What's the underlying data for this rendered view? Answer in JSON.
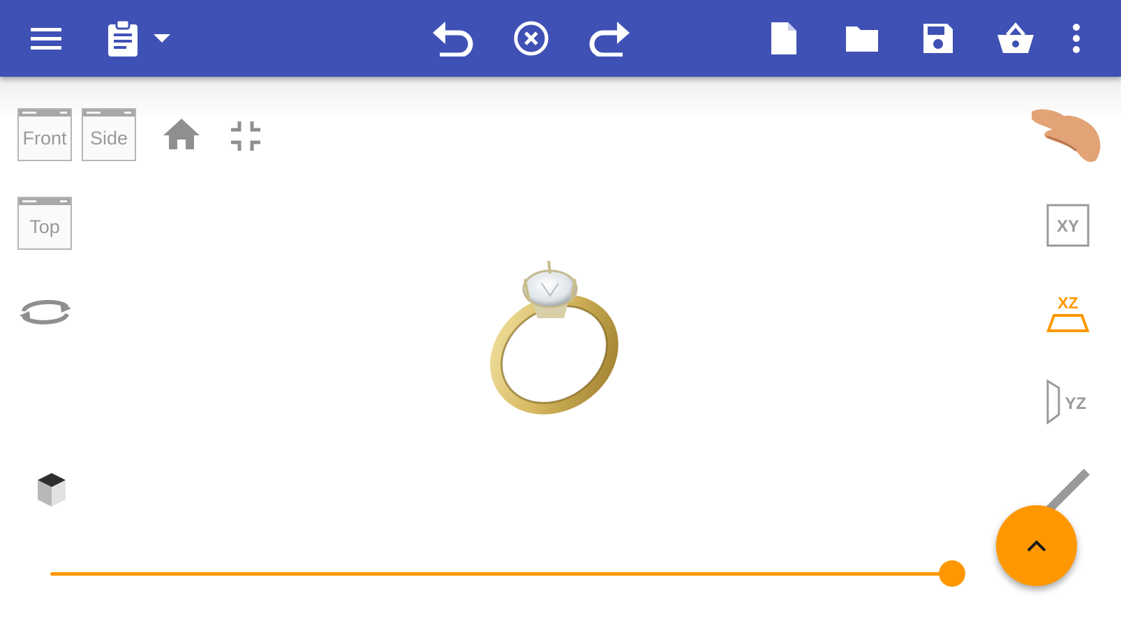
{
  "toolbar": {
    "icons": [
      "menu-icon",
      "clipboard-icon",
      "dropdown-icon",
      "undo-icon",
      "cancel-icon",
      "redo-icon",
      "new-file-icon",
      "open-folder-icon",
      "save-icon",
      "basket-icon",
      "more-vert-icon"
    ]
  },
  "views": {
    "front": "Front",
    "side": "Side",
    "top": "Top"
  },
  "planes": {
    "xy": "XY",
    "xz": "XZ",
    "yz": "YZ",
    "active": "XZ"
  },
  "slider": {
    "value_percent": 100
  },
  "colors": {
    "toolbar": "#3f51b5",
    "accent": "#ff9800",
    "icon_gray": "#8f8f8f"
  }
}
